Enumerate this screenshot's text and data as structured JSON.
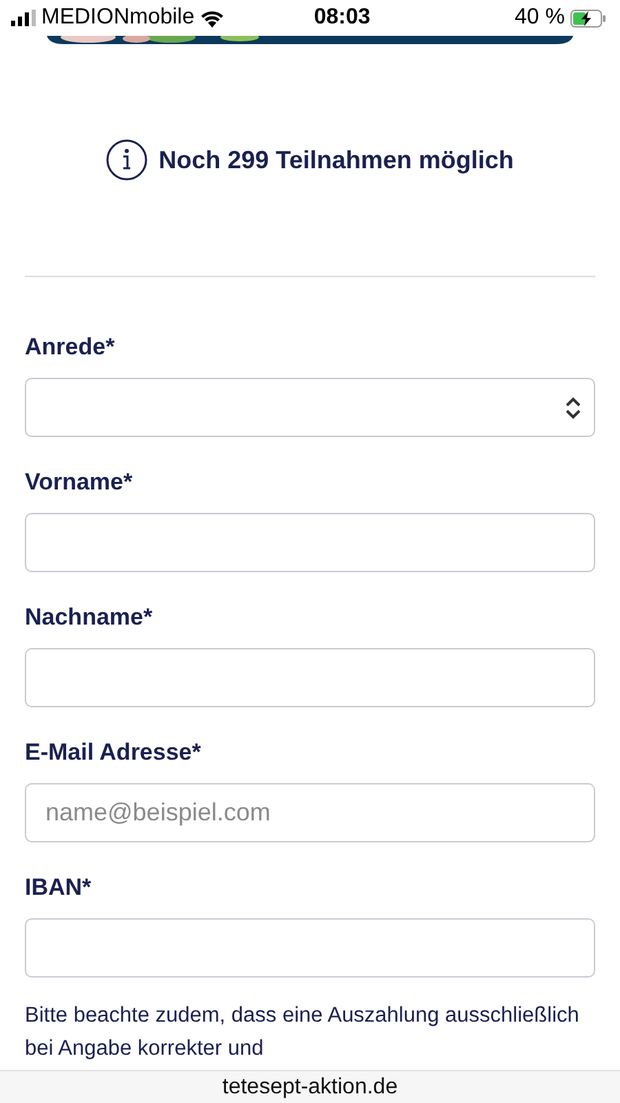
{
  "status_bar": {
    "carrier": "MEDIONmobile",
    "time": "08:03",
    "battery": "40 %"
  },
  "info": {
    "text": "Noch 299 Teilnahmen möglich"
  },
  "fields": [
    {
      "label": "Anrede*",
      "kind": "select"
    },
    {
      "label": "Vorname*",
      "kind": "input"
    },
    {
      "label": "Nachname*",
      "kind": "input"
    },
    {
      "label": "E-Mail Adresse*",
      "kind": "input",
      "placeholder": "name@beispiel.com"
    },
    {
      "label": "IBAN*",
      "kind": "input"
    }
  ],
  "note": "Bitte beachte zudem, dass eine Auszahlung ausschließlich bei Angabe korrekter und",
  "address_bar": {
    "url": "tetesept-aktion.de"
  }
}
